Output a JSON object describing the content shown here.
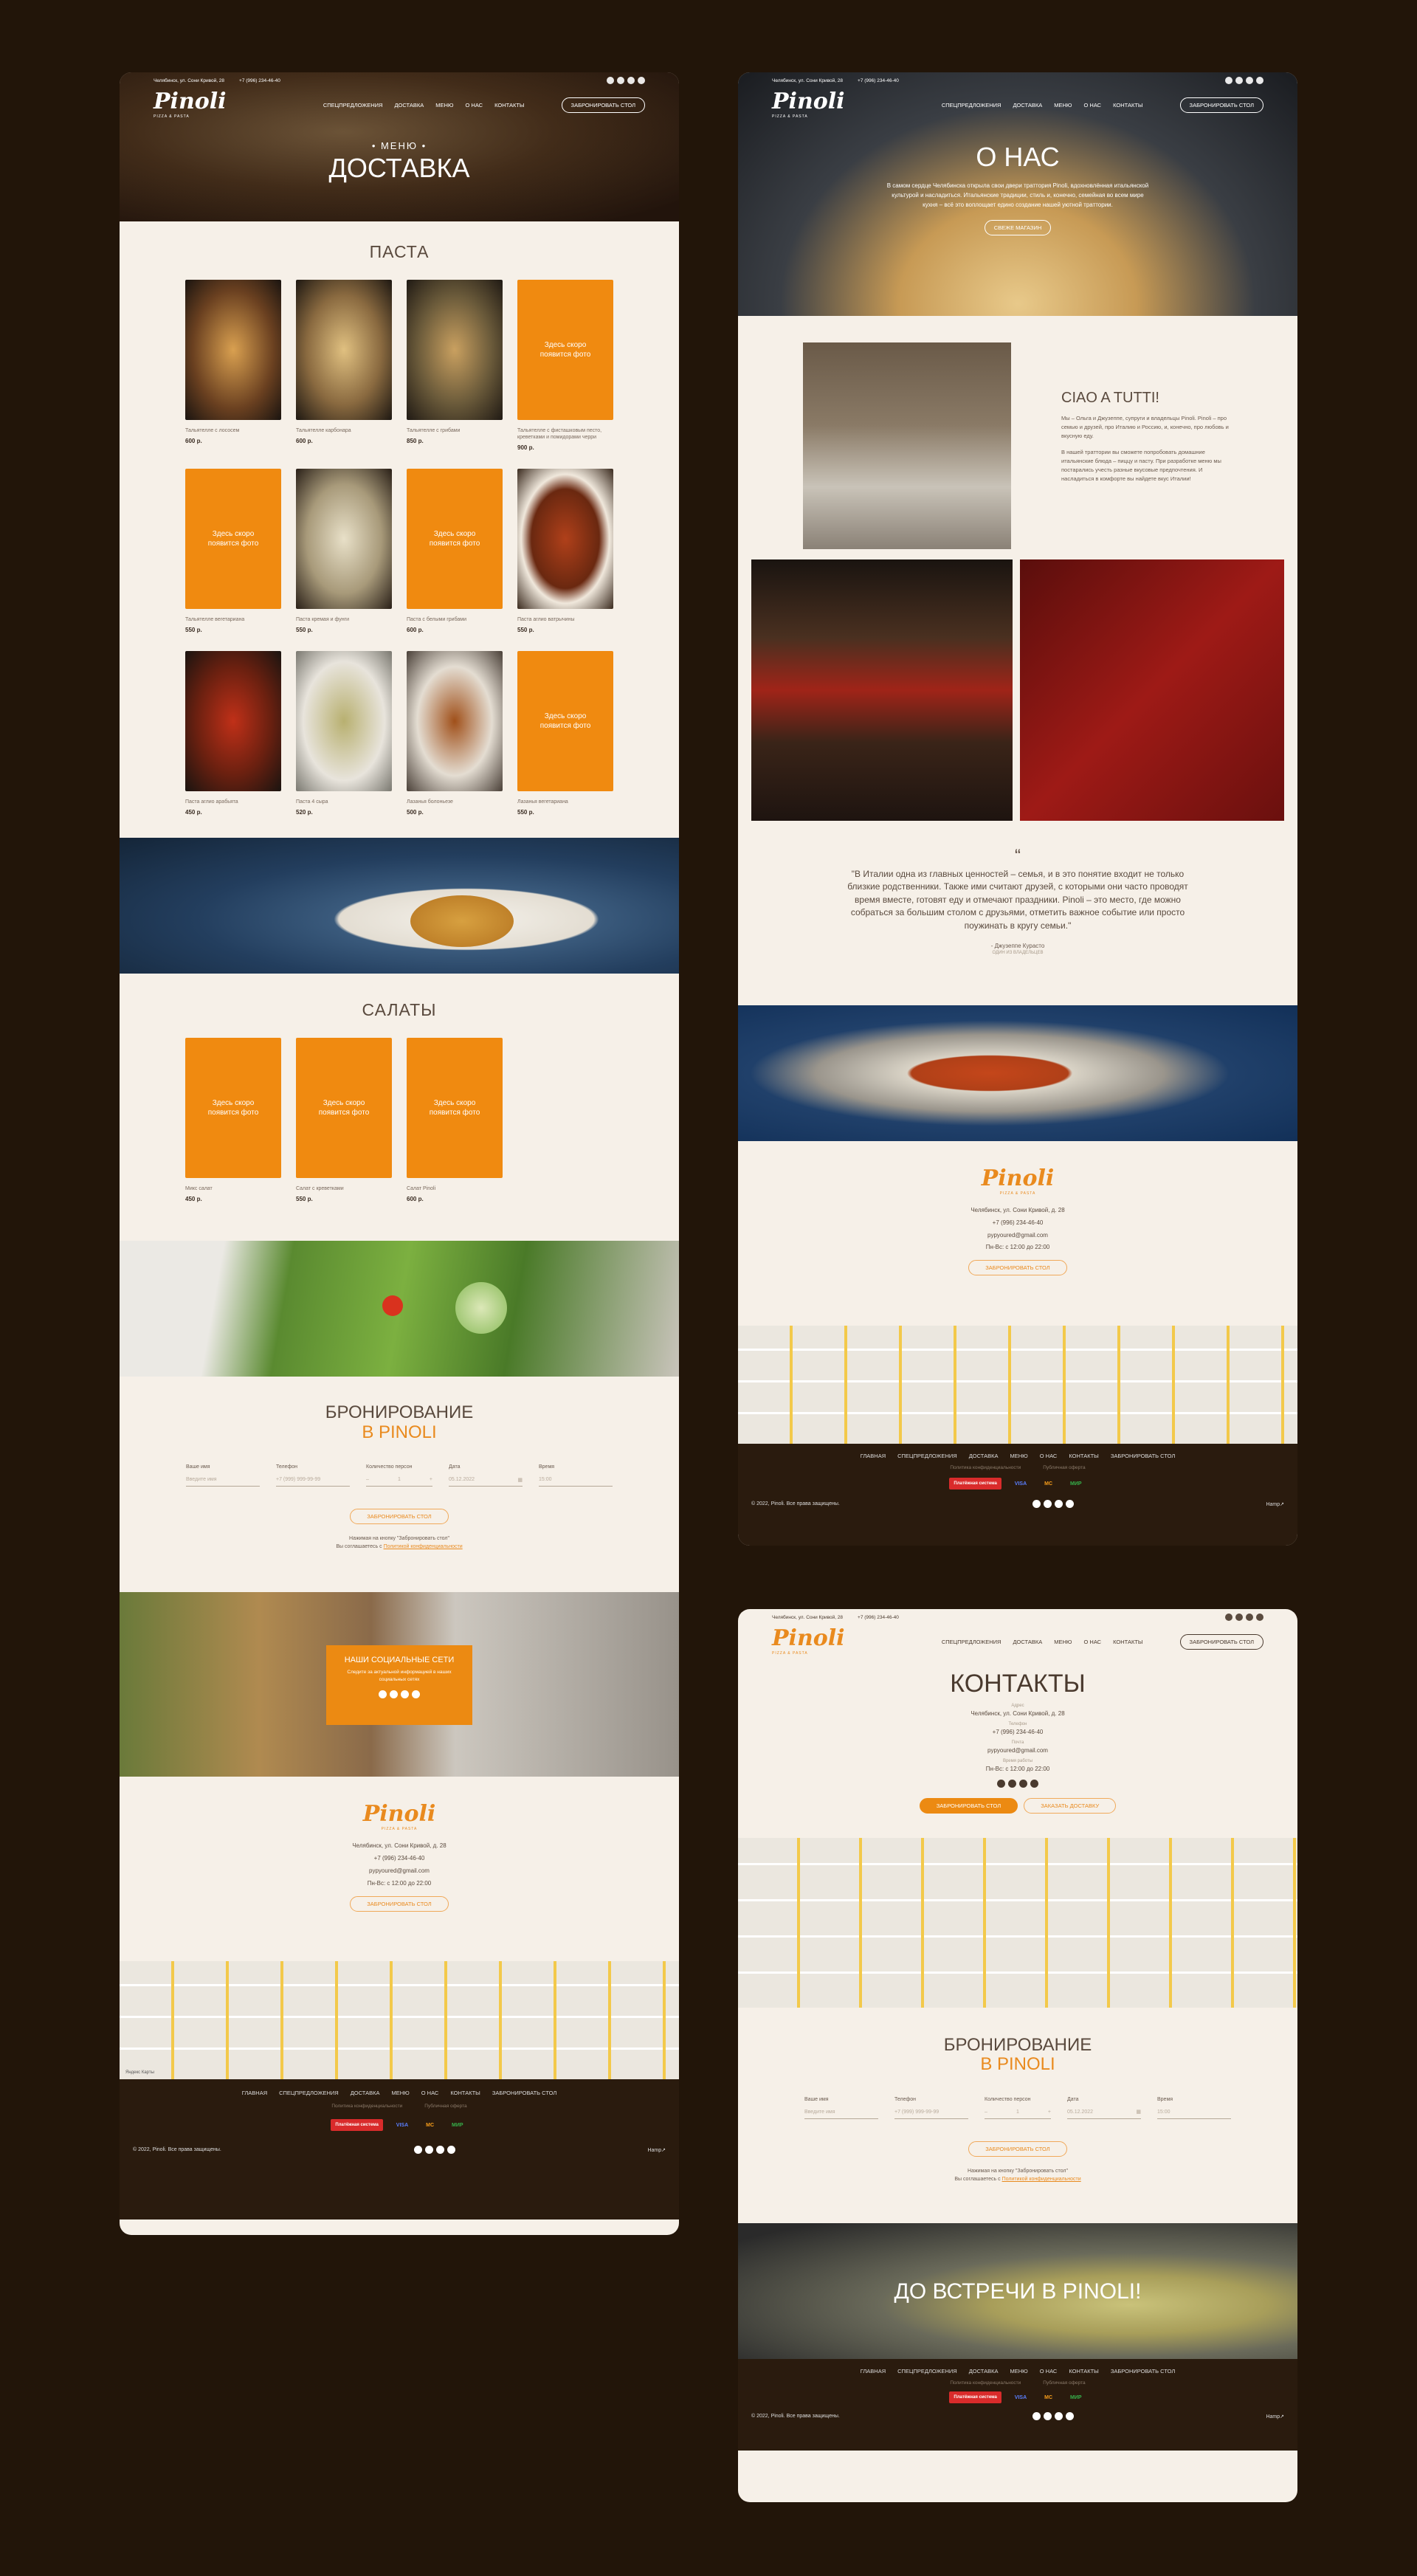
{
  "header": {
    "address": "Челябинск, ул. Сони Кривой, 28",
    "phone": "+7 (996) 234-46-40",
    "logo": "Pinoli",
    "logo_sub": "PIZZA & PASTA",
    "nav": [
      "СПЕЦПРЕДЛОЖЕНИЯ",
      "ДОСТАВКА",
      "МЕНЮ",
      "О НАС",
      "КОНТАКТЫ"
    ],
    "book_btn": "ЗАБРОНИРОВАТЬ СТОЛ"
  },
  "delivery": {
    "eyebrow": "• МЕНЮ •",
    "title": "ДОСТАВКА",
    "pasta_title": "ПАСТА",
    "salads_title": "САЛАТЫ",
    "placeholder": "Здесь скоро появится фото",
    "pasta": [
      {
        "name": "Тальятелле с лососем",
        "price": "600 р."
      },
      {
        "name": "Тальятелле карбонара",
        "price": "600 р."
      },
      {
        "name": "Тальятелле с грибами",
        "price": "850 р."
      },
      {
        "name": "Тальятелле с фисташковым песто, креветками и помидорами черри",
        "price": "900 р."
      },
      {
        "name": "Тальятелле вегетариана",
        "price": "550 р."
      },
      {
        "name": "Паста кремая и фунги",
        "price": "550 р."
      },
      {
        "name": "Паста с белыми грибами",
        "price": "600 р."
      },
      {
        "name": "Паста аглио ватрычины",
        "price": "550 р."
      },
      {
        "name": "Паста аглио арабьята",
        "price": "450 р."
      },
      {
        "name": "Паста 4 сыра",
        "price": "520 р."
      },
      {
        "name": "Лазанья болоньезе",
        "price": "500 р."
      },
      {
        "name": "Лазанья вегетариана",
        "price": "550 р."
      }
    ],
    "salads": [
      {
        "name": "Микс салат",
        "price": "450 р."
      },
      {
        "name": "Салат с креветками",
        "price": "550 р."
      },
      {
        "name": "Салат Pinoli",
        "price": "600 р."
      }
    ]
  },
  "booking": {
    "title1": "БРОНИРОВАНИЕ",
    "title2": "В PINOLI",
    "fields": [
      {
        "label": "Ваше имя",
        "value": "Введите имя"
      },
      {
        "label": "Телефон",
        "value": "+7 (999) 999-99-99"
      },
      {
        "label": "Количество персон",
        "value": "1"
      },
      {
        "label": "Дата",
        "value": "05.12.2022"
      },
      {
        "label": "Время",
        "value": "15:00"
      }
    ],
    "submit": "ЗАБРОНИРОВАТЬ СТОЛ",
    "note1": "Нажимая на кнопку \"Забронировать стол\"",
    "note2": "Вы соглашаетесь с",
    "note_link": "Политикой конфиденциальности"
  },
  "social": {
    "title": "НАШИ СОЦИАЛЬНЫЕ СЕТИ",
    "sub": "Следите за актуальной информацией в наших социальных сетях"
  },
  "contacts": {
    "address": "Челябинск, ул. Сони Кривой, д. 28",
    "phone": "+7 (996) 234-46-40",
    "email": "pypyoured@gmail.com",
    "hours": "Пн-Вс: с 12:00 до 22:00",
    "addr_label": "Адрес",
    "phone_label": "Телефон",
    "email_label": "Почта",
    "hours_label": "Время работы"
  },
  "footer": {
    "menu": [
      "ГЛАВНАЯ",
      "СПЕЦПРЕДЛОЖЕНИЯ",
      "ДОСТАВКА",
      "МЕНЮ",
      "О НАС",
      "КОНТАКТЫ",
      "ЗАБРОНИРОВАТЬ СТОЛ"
    ],
    "privacy": "Политика конфиденциальности",
    "offer": "Публичная оферта",
    "copyright": "© 2022, Pinoli. Все права защищены.",
    "dev": "Hamp↗",
    "pay": [
      "Платёжная система",
      "VISA",
      "MC",
      "МИР"
    ]
  },
  "about": {
    "title": "О НАС",
    "text": "В самом сердце Челябинска открыла свои двери траттория Pinoli, вдохновлённая итальянской культурой и насладиться. Итальянские традиции, стиль и, конечно, семейная во всем мире кухня – всё это воплощает едино создание нашей уютной траттории.",
    "cta": "СВЕЖЕ МАГАЗИН",
    "ciao": "CIAO A TUTTI!",
    "p1": "Мы – Ольга и Джузеппе, супруги и владельцы Pinoli. Pinoli – про семью и друзей, про Италию и Россию, и, конечно, про любовь и вкусную еду.",
    "p2": "В нашей траттории вы сможете попробовать домашние итальянские блюда – пиццу и пасту. При разработке меню мы постарались учесть разные вкусовые предпочтения. И насладиться в комфорте вы найдете вкус Италии!",
    "quote": "\"В Италии одна из главных ценностей – семья, и в это понятие входит не только близкие родственники. Также ими считают друзей, с которыми они часто проводят время вместе, готовят еду и отмечают праздники. Pinoli – это место, где можно собраться за большим столом с друзьями, отметить важное событие или просто поужинать в кругу семьи.\"",
    "author": "- Джузеппе Курасто",
    "author_sub": "ОДИН ИЗ ВЛАДЕЛЬЦЕВ"
  },
  "contacts_page": {
    "title": "КОНТАКТЫ",
    "btn1": "ЗАБРОНИРОВАТЬ СТОЛ",
    "btn2": "ЗАКАЗАТЬ ДОСТАВКУ",
    "closing": "ДО ВСТРЕЧИ В PINOLI!"
  },
  "map": {
    "label": "Яндекс Карты"
  },
  "colors": {
    "accent": "#f08a10",
    "bg": "#f6f0e8",
    "page": "#221509",
    "footer": "#2a1b0e"
  }
}
